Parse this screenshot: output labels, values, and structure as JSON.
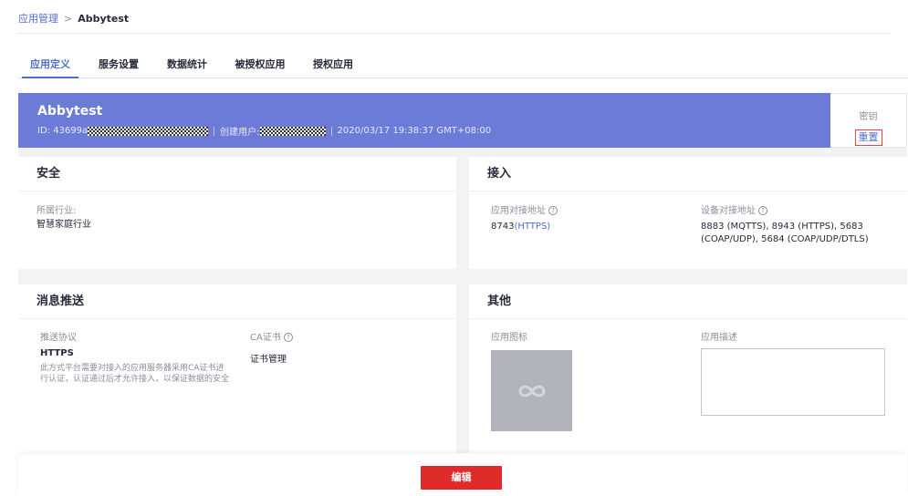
{
  "breadcrumb": {
    "parent": "应用管理",
    "separator": ">",
    "current": "Abbytest"
  },
  "tabs": [
    {
      "label": "应用定义",
      "active": true
    },
    {
      "label": "服务设置",
      "active": false
    },
    {
      "label": "数据统计",
      "active": false
    },
    {
      "label": "被授权应用",
      "active": false
    },
    {
      "label": "授权应用",
      "active": false
    }
  ],
  "banner": {
    "app_name": "Abbytest",
    "id_prefix": "ID: 43699a",
    "creator_label": "创建用户:",
    "created_time": "2020/03/17 19:38:37 GMT+08:00",
    "bg_color": "#6c7ad8"
  },
  "key_box": {
    "label": "密钥",
    "reset": "重置"
  },
  "security": {
    "title": "安全",
    "industry_label": "所属行业:",
    "industry_value": "智慧家庭行业"
  },
  "access": {
    "title": "接入",
    "app_addr_label": "应用对接地址",
    "app_addr_port": "8743",
    "app_addr_link": "(HTTPS)",
    "device_addr_label": "设备对接地址",
    "device_addr_value": "8883 (MQTTS), 8943 (HTTPS), 5683 (COAP/UDP), 5684 (COAP/UDP/DTLS)"
  },
  "push": {
    "title": "消息推送",
    "protocol_label": "推送协议",
    "protocol_value": "HTTPS",
    "protocol_desc": "此方式平台需要对接入的应用服务器采用CA证书进行认证，认证通过后才允许接入，以保证数据的安全",
    "ca_label": "CA证书",
    "ca_link": "证书管理"
  },
  "other": {
    "title": "其他",
    "icon_label": "应用图标",
    "desc_label": "应用描述"
  },
  "footer": {
    "edit": "编辑",
    "edit_color": "#e02b2b"
  },
  "icons": {
    "help": "question-circle-icon",
    "app_logo": "infinity-icon"
  }
}
